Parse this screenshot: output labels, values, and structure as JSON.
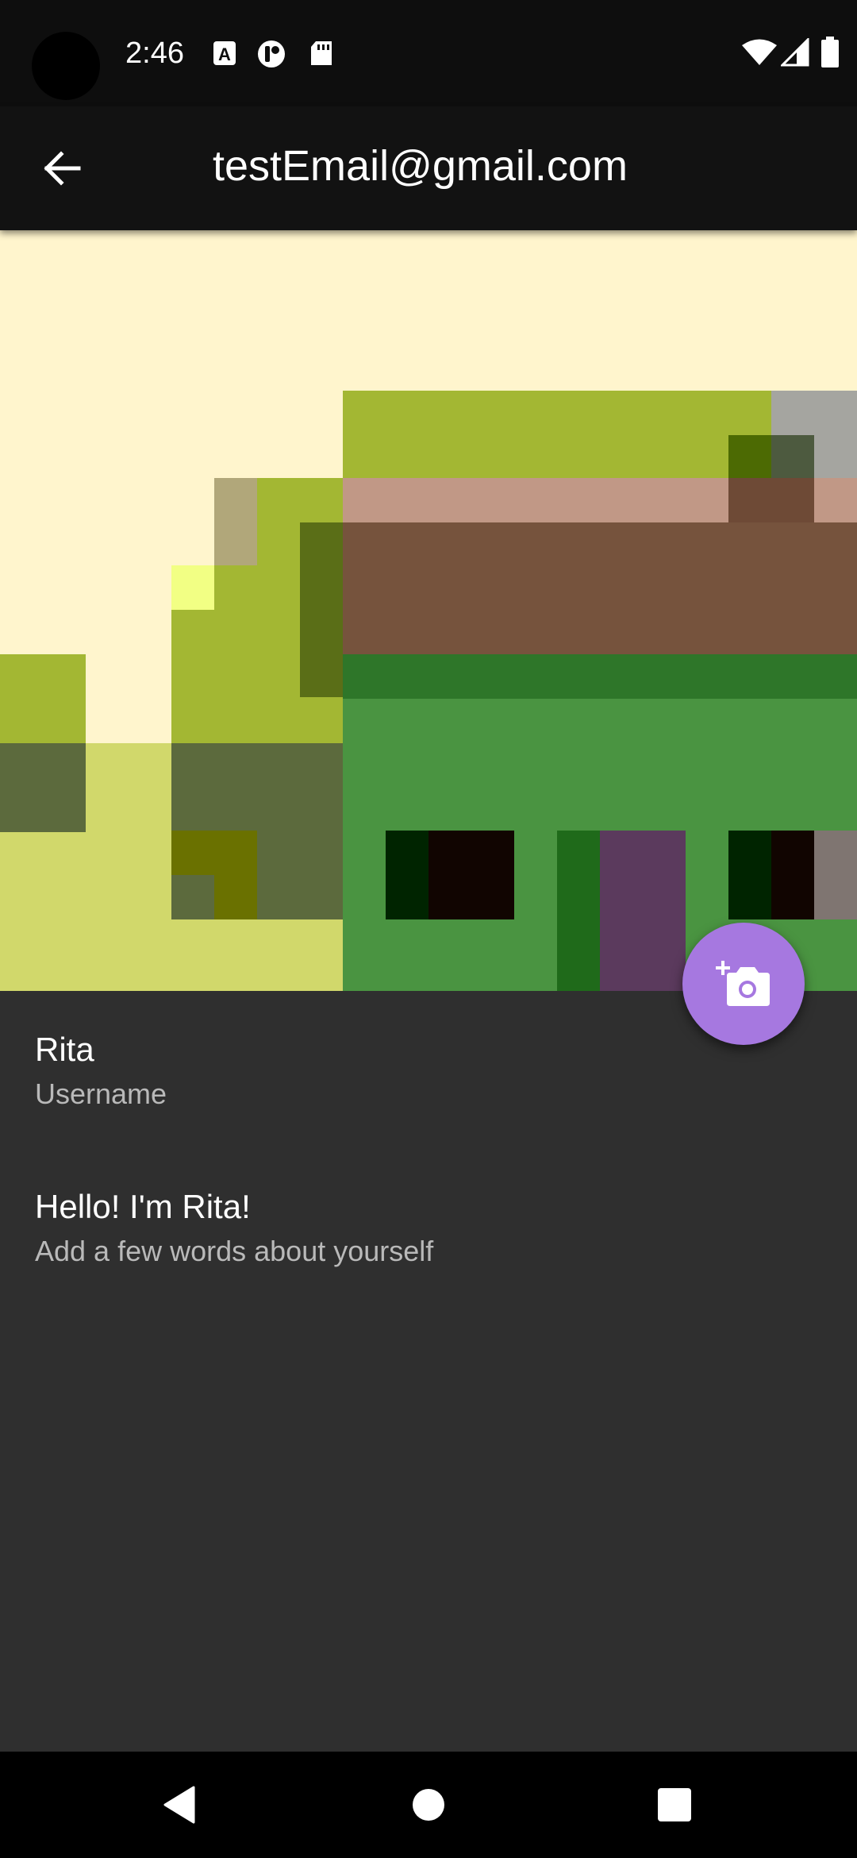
{
  "status_bar": {
    "time": "2:46",
    "left_icons": [
      "a-notification-icon",
      "tie-notification-icon",
      "sd-card-icon"
    ],
    "right_icons": [
      "wifi-icon",
      "cellular-signal-icon",
      "battery-icon"
    ]
  },
  "app_bar": {
    "title": "testEmail@gmail.com",
    "back_icon": "arrow-back-icon"
  },
  "banner": {
    "description_icon": "pixel-art-cover-image"
  },
  "fab": {
    "icon": "add-photo-camera-icon",
    "color": "#a678e0"
  },
  "profile": {
    "username_value": "Rita",
    "username_label": "Username",
    "bio_value": "Hello! I'm Rita!",
    "bio_label": "Add a few words about yourself"
  },
  "nav_bar": {
    "back_icon": "nav-back-triangle-icon",
    "home_icon": "nav-home-circle-icon",
    "recents_icon": "nav-recents-square-icon"
  },
  "colors": {
    "background": "#2f2f2f",
    "app_bar": "#121212",
    "status_bar": "#0e0e0e"
  }
}
